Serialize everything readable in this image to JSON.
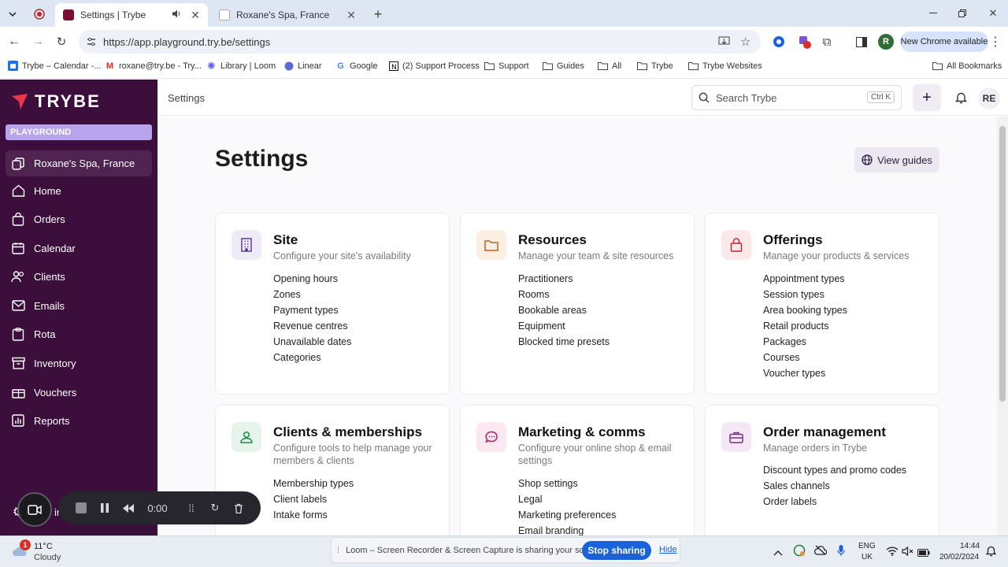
{
  "browser": {
    "tabs": [
      {
        "title": "Settings | Trybe",
        "active": true
      },
      {
        "title": "Roxane's Spa, France",
        "active": false
      }
    ],
    "url": "https://app.playground.try.be/settings",
    "new_chrome": "New Chrome available",
    "profile_initial": "R",
    "bookmarks": [
      "Trybe – Calendar -...",
      "roxane@try.be - Try...",
      "Library | Loom",
      "Linear",
      "Google",
      "(2) Support Process",
      "Support",
      "Guides",
      "All",
      "Trybe",
      "Trybe Websites"
    ],
    "all_bookmarks": "All Bookmarks"
  },
  "app": {
    "logo": "TRYBE",
    "environment": "PLAYGROUND",
    "site_name": "Roxane's Spa, France",
    "nav": [
      "Home",
      "Orders",
      "Calendar",
      "Clients",
      "Emails",
      "Rota",
      "Inventory",
      "Vouchers",
      "Reports"
    ],
    "bottom_nav_partial": "ings",
    "breadcrumb": "Settings",
    "search_placeholder": "Search Trybe",
    "search_shortcut": "Ctrl K",
    "plus": "+",
    "avatar": "RE"
  },
  "page": {
    "title": "Settings",
    "guides_button": "View guides",
    "cards": [
      {
        "title": "Site",
        "desc": "Configure your site's availability",
        "items": [
          "Opening hours",
          "Zones",
          "Payment types",
          "Revenue centres",
          "Unavailable dates",
          "Categories"
        ]
      },
      {
        "title": "Resources",
        "desc": "Manage your team & site resources",
        "items": [
          "Practitioners",
          "Rooms",
          "Bookable areas",
          "Equipment",
          "Blocked time presets"
        ]
      },
      {
        "title": "Offerings",
        "desc": "Manage your products & services",
        "items": [
          "Appointment types",
          "Session types",
          "Area booking types",
          "Retail products",
          "Packages",
          "Courses",
          "Voucher types"
        ]
      },
      {
        "title": "Clients & memberships",
        "desc": "Configure tools to help manage your members & clients",
        "items": [
          "Membership types",
          "Client labels",
          "Intake forms"
        ]
      },
      {
        "title": "Marketing & comms",
        "desc": "Configure your online shop & email settings",
        "items": [
          "Shop settings",
          "Legal",
          "Marketing preferences",
          "Email branding"
        ]
      },
      {
        "title": "Order management",
        "desc": "Manage orders in Trybe",
        "items": [
          "Discount types and promo codes",
          "Sales channels",
          "Order labels"
        ]
      }
    ]
  },
  "loom": {
    "timer": "0:00",
    "share_message": "Loom – Screen Recorder & Screen Capture is sharing your screen.",
    "stop": "Stop sharing",
    "hide": "Hide"
  },
  "taskbar": {
    "weather_badge": "1",
    "temp": "11°C",
    "condition": "Cloudy",
    "lang1": "ENG",
    "lang2": "UK",
    "time": "14:44",
    "date": "20/02/2024"
  },
  "colors": {
    "sidebar": "#3b0e3c",
    "accent_site": "#5b3c9e",
    "accent_resources": "#c0601f",
    "accent_offerings": "#c0252f",
    "accent_clients": "#1f8a47",
    "accent_marketing": "#b01f64",
    "accent_orders": "#7a2d88"
  }
}
